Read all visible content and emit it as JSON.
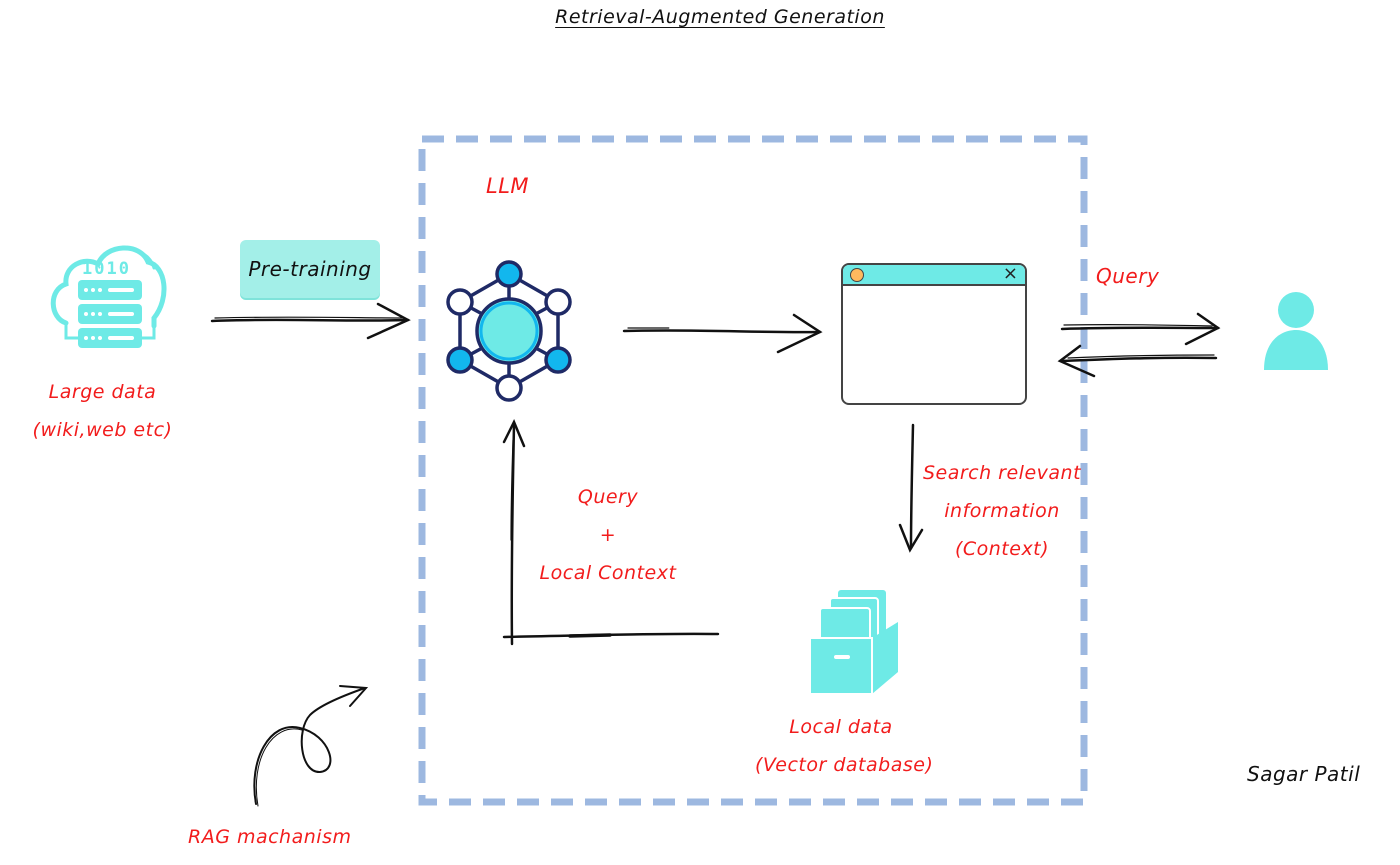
{
  "title": "Retrieval-Augmented Generation",
  "colors": {
    "label_red": "#f21c1c",
    "teal": "#6eeae6",
    "teal_light": "#a3efe8",
    "dashed_border": "#9db8e0",
    "node_blue": "#12b7ee",
    "node_outline": "#1f2a66",
    "window_dot": "#ffb95e",
    "arrow": "#111111"
  },
  "nodes": {
    "large_data": {
      "icon": "cloud-server-icon",
      "line1": "Large data",
      "line2": "(wiki,web etc)",
      "binary_text": "1010"
    },
    "pretraining": {
      "label": "Pre-training"
    },
    "llm": {
      "label": "LLM",
      "icon": "neural-network-icon"
    },
    "app_window": {
      "icon": "app-window-icon",
      "close_glyph": "×"
    },
    "user": {
      "icon": "user-icon"
    },
    "query_user": {
      "label": "Query"
    },
    "search": {
      "line1": "Search relevant",
      "line2": "information",
      "line3": "(Context)"
    },
    "query_context": {
      "line1": "Query",
      "line2": "+",
      "line3": "Local Context"
    },
    "local_data": {
      "icon": "file-cabinet-icon",
      "line1": "Local data",
      "line2": "(Vector database)"
    },
    "rag": {
      "label": "RAG machanism"
    },
    "author": {
      "label": "Sagar Patil"
    }
  }
}
